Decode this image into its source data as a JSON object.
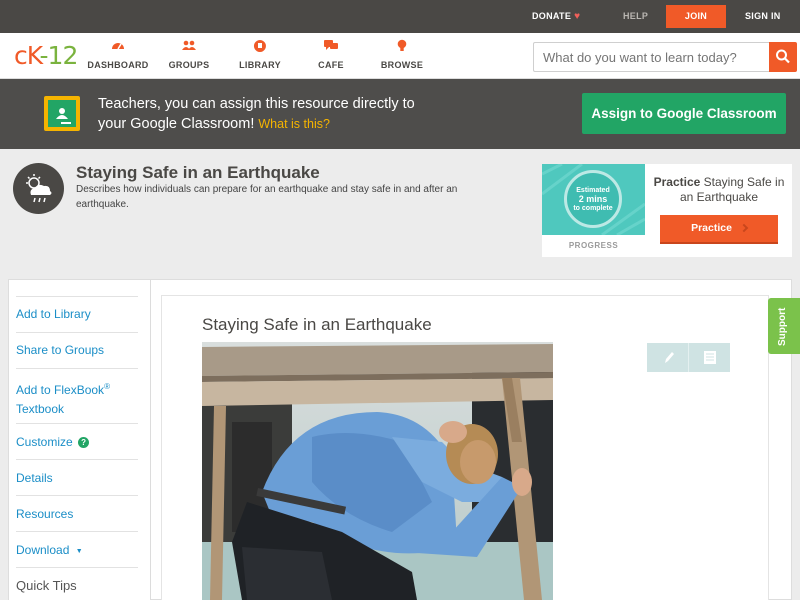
{
  "topbar": {
    "donate": "DONATE",
    "help": "HELP",
    "join": "JOIN",
    "signin": "SIGN IN"
  },
  "logo": {
    "ck": "cK",
    "dash": "-",
    "num": "12"
  },
  "nav": [
    {
      "label": "DASHBOARD",
      "icon": "dashboard-icon"
    },
    {
      "label": "GROUPS",
      "icon": "groups-icon"
    },
    {
      "label": "LIBRARY",
      "icon": "library-icon"
    },
    {
      "label": "CAFE",
      "icon": "cafe-icon"
    },
    {
      "label": "BROWSE",
      "icon": "browse-icon"
    }
  ],
  "search": {
    "placeholder": "What do you want to learn today?"
  },
  "banner": {
    "line1": "Teachers, you can assign this resource directly to",
    "line2": "your Google Classroom!",
    "what_link": "What is this?",
    "assign_button": "Assign to Google Classroom"
  },
  "concept": {
    "title": "Staying Safe in an Earthquake",
    "description": "Describes how individuals can prepare for an earthquake and stay safe in and after an earthquake."
  },
  "practice_card": {
    "estimated": "Estimated",
    "minutes": "2 mins",
    "to_complete": "to complete",
    "progress_label": "PROGRESS",
    "heading_bold": "Practice",
    "heading_rest": "Staying Safe in an Earthquake",
    "button": "Practice"
  },
  "rail": {
    "add_library": "Add to Library",
    "share_groups": "Share to Groups",
    "add_flexbook_1": "Add to FlexBook",
    "add_flexbook_reg": "®",
    "add_flexbook_2": "Textbook",
    "customize": "Customize",
    "customize_q": "?",
    "details": "Details",
    "resources": "Resources",
    "download": "Download",
    "download_caret": "▼",
    "quick_tips": "Quick Tips"
  },
  "article": {
    "title": "Staying Safe in an Earthquake"
  },
  "support": "Support",
  "colors": {
    "brand_orange": "#f05a28",
    "brand_green": "#7ab33e",
    "google_green": "#22a565",
    "link_blue": "#1b8ec7",
    "practice_teal": "#4fc8be"
  }
}
